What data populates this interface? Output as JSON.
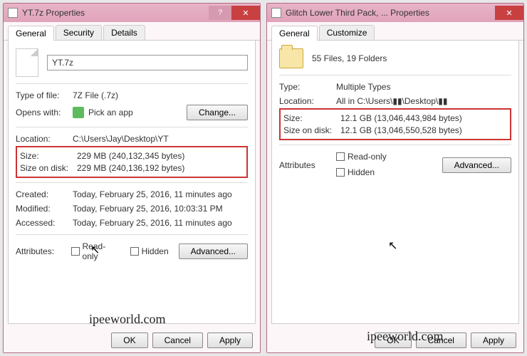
{
  "left": {
    "title": "YT.7z Properties",
    "tabs": [
      "General",
      "Security",
      "Details"
    ],
    "filename": "YT.7z",
    "typeLabel": "Type of file:",
    "typeValue": "7Z File (.7z)",
    "opensLabel": "Opens with:",
    "opensValue": "Pick an app",
    "changeBtn": "Change...",
    "locationLabel": "Location:",
    "locationValue": "C:\\Users\\Jay\\Desktop\\YT",
    "sizeLabel": "Size:",
    "sizeValue": "229 MB (240,132,345 bytes)",
    "sizeDiskLabel": "Size on disk:",
    "sizeDiskValue": "229 MB (240,136,192 bytes)",
    "createdLabel": "Created:",
    "createdValue": "Today, February 25, 2016, 11 minutes ago",
    "modifiedLabel": "Modified:",
    "modifiedValue": "Today, February 25, 2016, 10:03:31 PM",
    "accessedLabel": "Accessed:",
    "accessedValue": "Today, February 25, 2016, 11 minutes ago",
    "attrLabel": "Attributes:",
    "readonly": "Read-only",
    "hidden": "Hidden",
    "advanced": "Advanced...",
    "ok": "OK",
    "cancel": "Cancel",
    "apply": "Apply",
    "watermark": "ipeeworld.com"
  },
  "right": {
    "title": "Glitch Lower Third Pack, ... Properties",
    "tabs": [
      "General",
      "Customize"
    ],
    "summary": "55 Files, 19 Folders",
    "typeLabel": "Type:",
    "typeValue": "Multiple Types",
    "locationLabel": "Location:",
    "locationValue": "All in C:\\Users\\▮▮\\Desktop\\▮▮",
    "sizeLabel": "Size:",
    "sizeValue": "12.1 GB (13,046,443,984 bytes)",
    "sizeDiskLabel": "Size on disk:",
    "sizeDiskValue": "12.1 GB (13,046,550,528 bytes)",
    "attrLabel": "Attributes",
    "readonly": "Read-only",
    "hidden": "Hidden",
    "advanced": "Advanced...",
    "ok": "OK",
    "cancel": "Cancel",
    "apply": "Apply",
    "watermark": "ipeeworld.com"
  }
}
